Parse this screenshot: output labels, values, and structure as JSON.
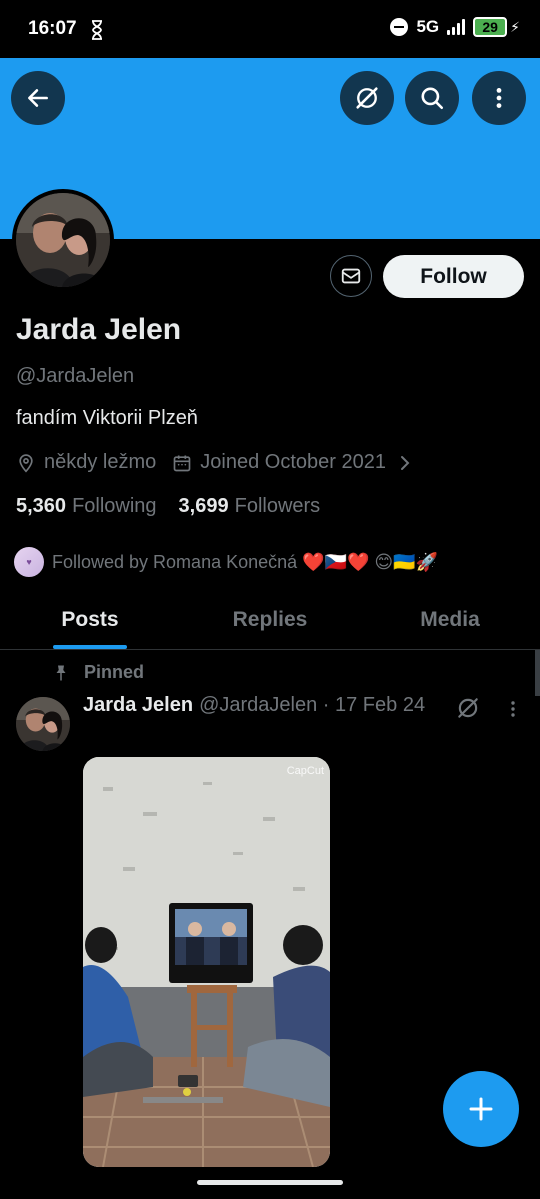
{
  "status_bar": {
    "time": "16:07",
    "network": "5G",
    "battery": "29",
    "icons": [
      "hourglass-icon",
      "do-not-disturb-icon",
      "signal-icon",
      "battery-icon",
      "charging-icon"
    ]
  },
  "colors": {
    "banner": "#1d9bf0",
    "accent": "#1d9bf0",
    "background": "#000000",
    "text_primary": "#e7e9ea",
    "text_secondary": "#71767b",
    "follow_bg": "#eff3f4"
  },
  "header": {
    "icons": [
      "back-arrow-icon",
      "grok-icon",
      "search-icon",
      "more-vertical-icon"
    ]
  },
  "profile": {
    "name": "Jarda Jelen",
    "handle": "@JardaJelen",
    "bio": "fandím Viktorii Plzeň",
    "location": "někdy ležmo",
    "joined": "Joined October 2021",
    "following_count": "5,360",
    "following_label": "Following",
    "followers_count": "3,699",
    "followers_label": "Followers",
    "followed_by": "Followed by Romana Konečná ❤️🇨🇿❤️ 😊🇺🇦🚀",
    "follow_button": "Follow"
  },
  "tabs": [
    {
      "label": "Posts",
      "active": true
    },
    {
      "label": "Replies",
      "active": false
    },
    {
      "label": "Media",
      "active": false
    }
  ],
  "pinned_post": {
    "pinned_label": "Pinned",
    "author_name": "Jarda Jelen",
    "author_meta": "@JardaJelen · 17 Feb 24",
    "media_watermark": "CapCut"
  }
}
